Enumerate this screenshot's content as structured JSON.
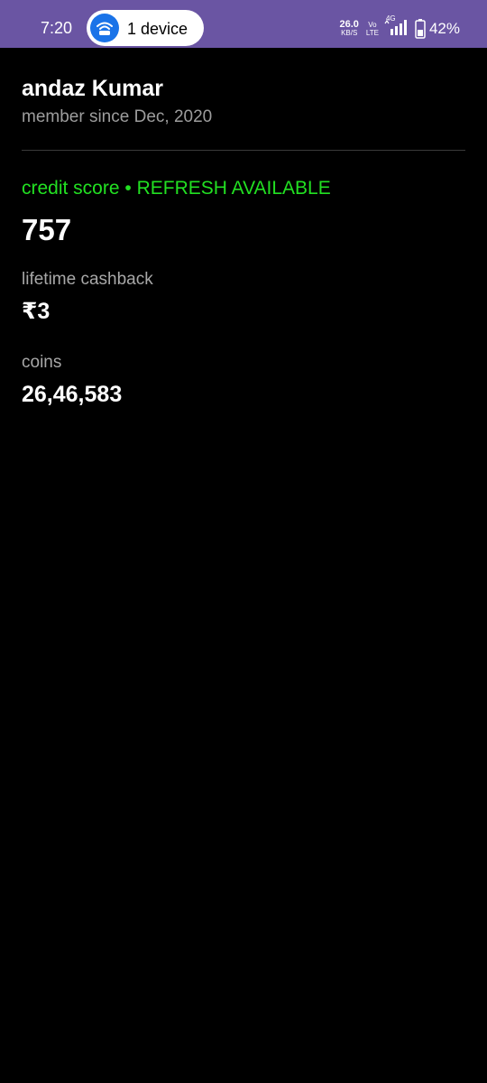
{
  "status_bar": {
    "time": "7:20",
    "hotspot_pill": {
      "label": "1 device",
      "icon": "wifi-hotspot-icon"
    },
    "net_speed_value": "26.0",
    "net_speed_unit": "KB/S",
    "volte_top": "Vo",
    "volte_bottom": "LTE",
    "network_type": "4G",
    "battery_percent": "42%",
    "bar_color": "#6a55a3"
  },
  "profile": {
    "name": "andaz Kumar",
    "member_since": "member since Dec, 2020"
  },
  "credit_score": {
    "label": "credit score",
    "separator": "•",
    "status": "REFRESH AVAILABLE",
    "value": "757",
    "accent_color": "#22e022"
  },
  "lifetime_cashback": {
    "label": "lifetime cashback",
    "value": "₹3"
  },
  "coins": {
    "label": "coins",
    "value": "26,46,583"
  }
}
